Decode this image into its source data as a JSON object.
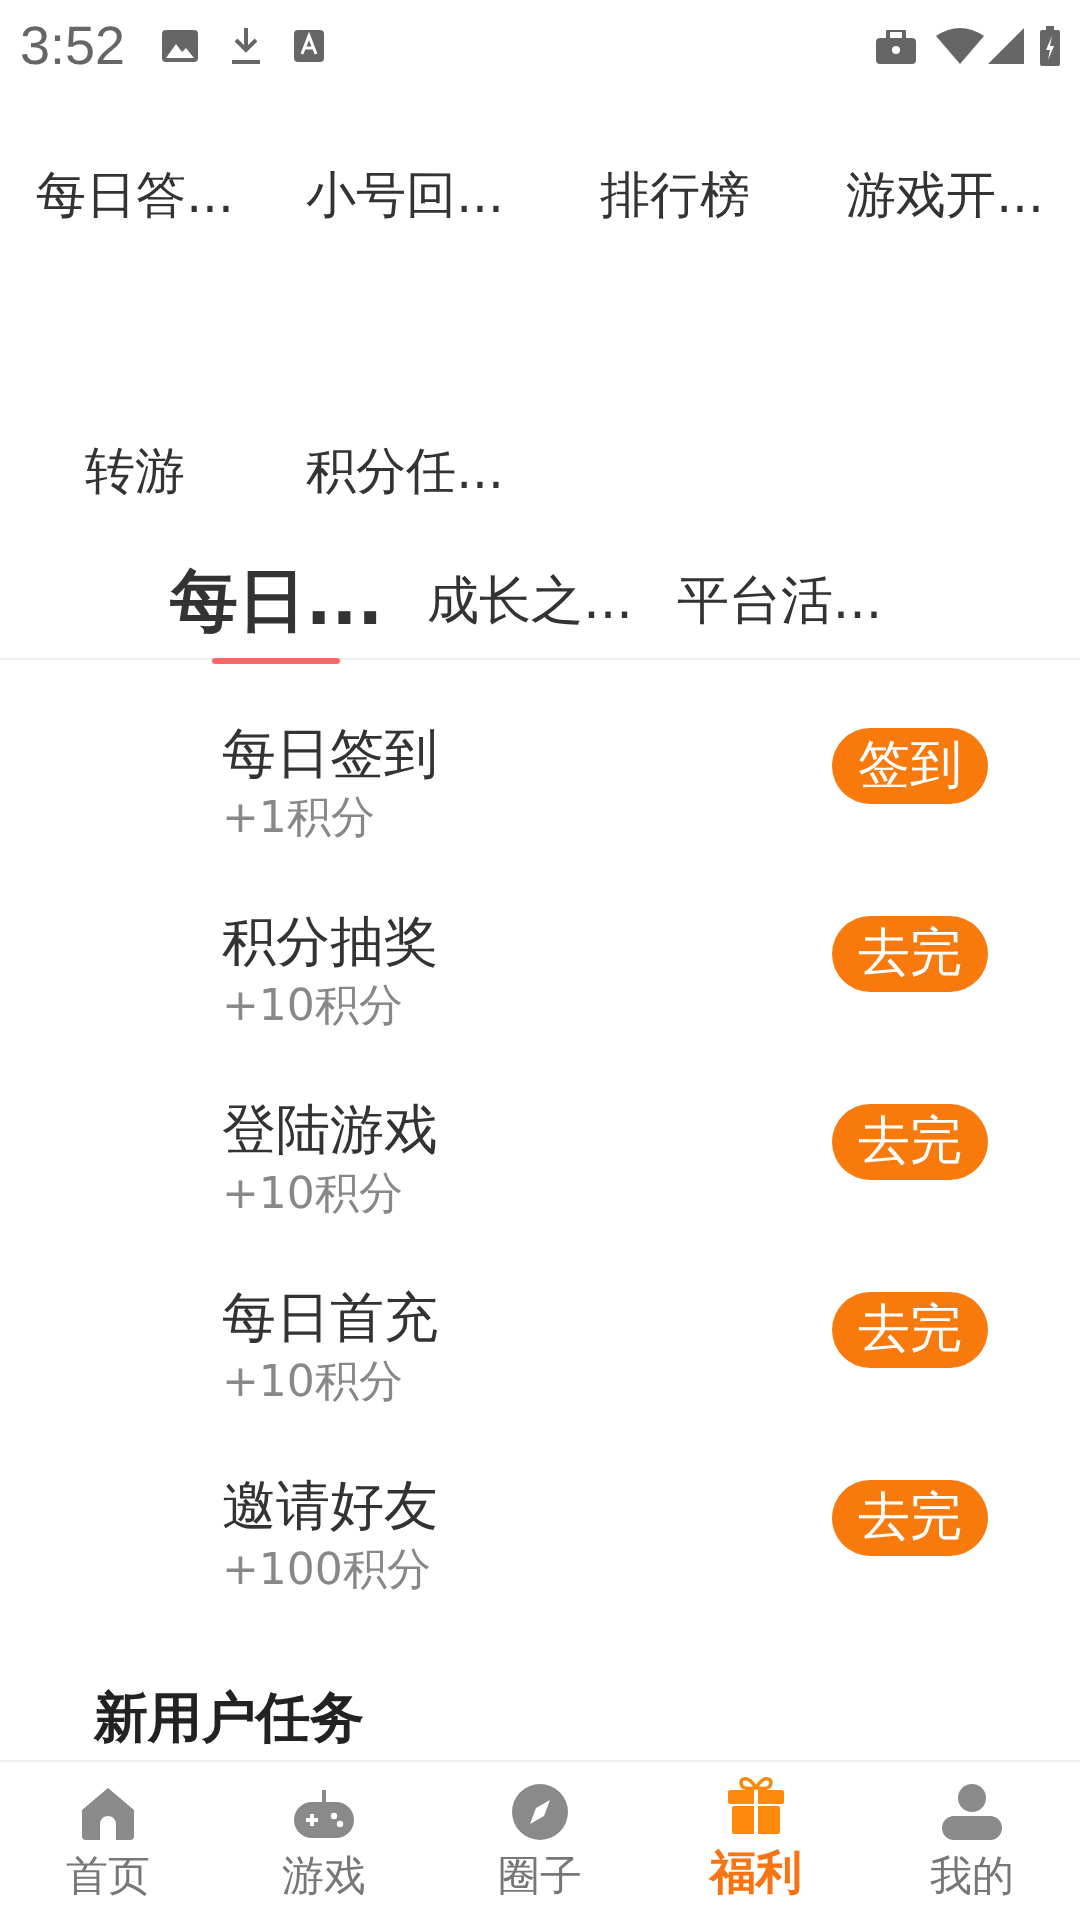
{
  "status_bar": {
    "time": "3:52"
  },
  "menu": [
    {
      "label": "每日答..."
    },
    {
      "label": "小号回..."
    },
    {
      "label": "排行榜"
    },
    {
      "label": "游戏开..."
    },
    {
      "label": "转游"
    },
    {
      "label": "积分任..."
    }
  ],
  "tabs": [
    {
      "label": "每日...",
      "selected": true
    },
    {
      "label": "成长之...",
      "selected": false
    },
    {
      "label": "平台活...",
      "selected": false
    }
  ],
  "tasks": [
    {
      "title": "每日签到",
      "reward": "+1积分",
      "action": "签到"
    },
    {
      "title": "积分抽奖",
      "reward": "+10积分",
      "action": "去完"
    },
    {
      "title": "登陆游戏",
      "reward": "+10积分",
      "action": "去完"
    },
    {
      "title": "每日首充",
      "reward": "+10积分",
      "action": "去完"
    },
    {
      "title": "邀请好友",
      "reward": "+100积分",
      "action": "去完"
    }
  ],
  "section_title": "新用户任务",
  "bottom_nav": [
    {
      "label": "首页",
      "kind": "home",
      "selected": false
    },
    {
      "label": "游戏",
      "kind": "game",
      "selected": false
    },
    {
      "label": "圈子",
      "kind": "compass",
      "selected": false
    },
    {
      "label": "福利",
      "kind": "gift",
      "selected": true
    },
    {
      "label": "我的",
      "kind": "user",
      "selected": false
    }
  ]
}
